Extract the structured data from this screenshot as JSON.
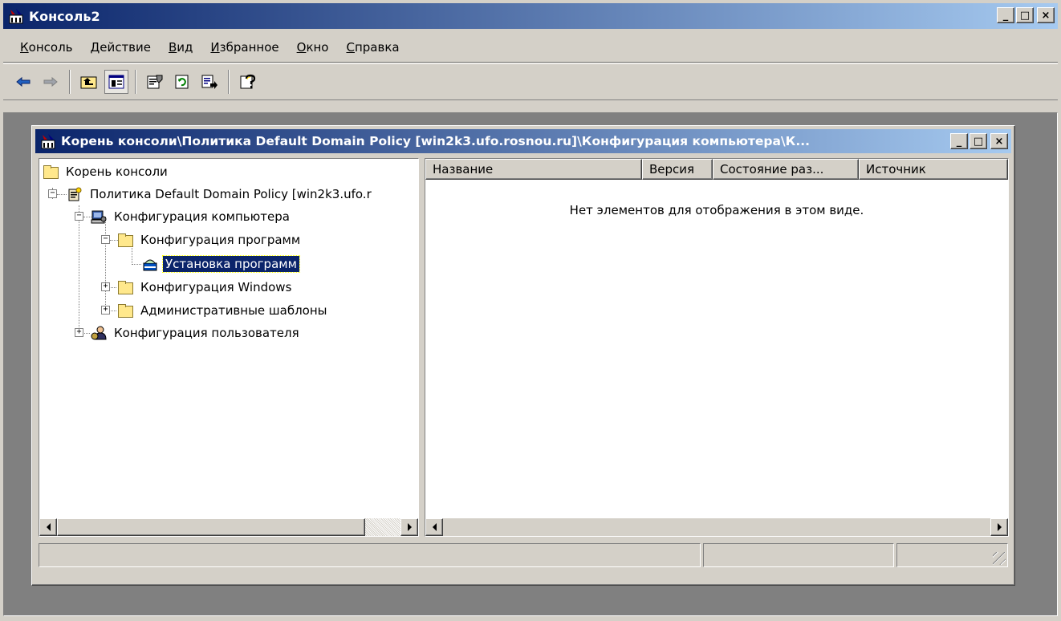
{
  "app": {
    "title": "Консоль2"
  },
  "caption_buttons": {
    "minimize": "_",
    "maximize": "□",
    "close": "×"
  },
  "menu": {
    "items": [
      {
        "label": "Консоль",
        "key": "К",
        "rest": "онсоль"
      },
      {
        "label": "Действие",
        "key": "Д",
        "rest": "ействие"
      },
      {
        "label": "Вид",
        "key": "В",
        "rest": "ид"
      },
      {
        "label": "Избранное",
        "key": "И",
        "rest": "збранное"
      },
      {
        "label": "Окно",
        "key": "О",
        "rest": "кно"
      },
      {
        "label": "Справка",
        "key": "С",
        "rest": "правка"
      }
    ]
  },
  "toolbar": {
    "buttons": [
      "back-arrow-icon",
      "forward-arrow-icon",
      "up-one-level-icon",
      "show-hide-tree-icon",
      "properties-icon",
      "refresh-icon",
      "export-list-icon",
      "help-icon"
    ]
  },
  "child_window": {
    "title": "Корень консоли\\Политика Default Domain Policy [win2k3.ufo.rosnou.ru]\\Конфигурация компьютера\\К...",
    "title_bold_part": "Корень консоли\\Политика Default Domain Policy [win2k3.ufo.rosnou.ru]\\",
    "title_rest_part": "Конфигурация компьютера\\К..."
  },
  "tree": {
    "items": [
      {
        "label": "Корень консоли"
      },
      {
        "label": "Политика Default Domain Policy [win2k3.ufo.r"
      },
      {
        "label": "Конфигурация компьютера"
      },
      {
        "label": "Конфигурация программ"
      },
      {
        "label": "Установка программ",
        "selected": true
      },
      {
        "label": "Конфигурация Windows"
      },
      {
        "label": "Административные шаблоны"
      },
      {
        "label": "Конфигурация пользователя"
      }
    ]
  },
  "list": {
    "columns": [
      "Название",
      "Версия",
      "Состояние раз...",
      "Источник"
    ],
    "empty_message": "Нет элементов для отображения в этом виде."
  },
  "colors": {
    "title_active_start": "#0a246a",
    "title_active_end": "#a6caf0",
    "face": "#d4d0c8",
    "mdi_background": "#808080",
    "selection": "#0a246a"
  }
}
